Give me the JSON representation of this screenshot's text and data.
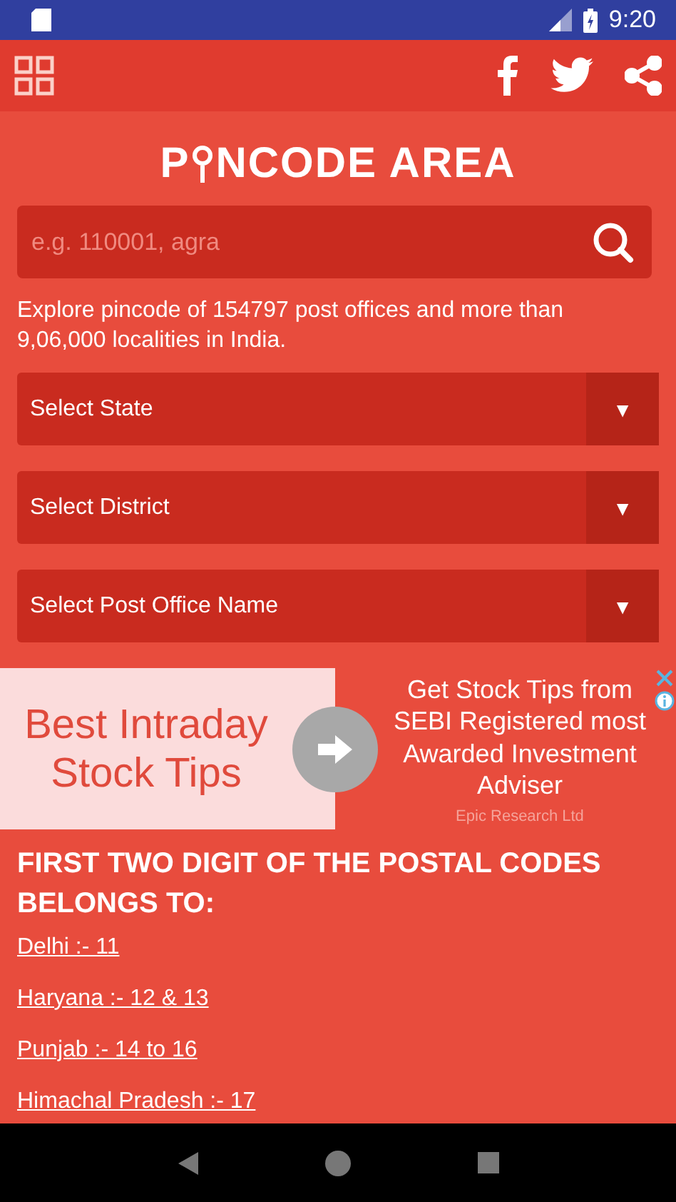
{
  "status_bar": {
    "time": "9:20"
  },
  "logo": {
    "before": "P",
    "after": "NCODE AREA"
  },
  "search": {
    "placeholder": "e.g. 110001, agra"
  },
  "description": "Explore pincode of 154797 post offices and more than 9,06,000 localities in India.",
  "dropdowns": [
    {
      "label": "Select State",
      "arrow": "▼"
    },
    {
      "label": "Select District",
      "arrow": "▼"
    },
    {
      "label": "Select Post Office Name",
      "arrow": "▼"
    }
  ],
  "ad": {
    "headline": "Best Intraday Stock Tips",
    "body": "Get Stock Tips from SEBI Registered most Awarded Investment Adviser",
    "advertiser": "Epic Research Ltd"
  },
  "postal_codes": {
    "heading": "FIRST TWO DIGIT OF THE POSTAL CODES BELONGS TO:",
    "items": [
      "Delhi :- 11",
      "Haryana :- 12 & 13",
      "Punjab :- 14 to 16",
      "Himachal Pradesh :- 17"
    ]
  }
}
